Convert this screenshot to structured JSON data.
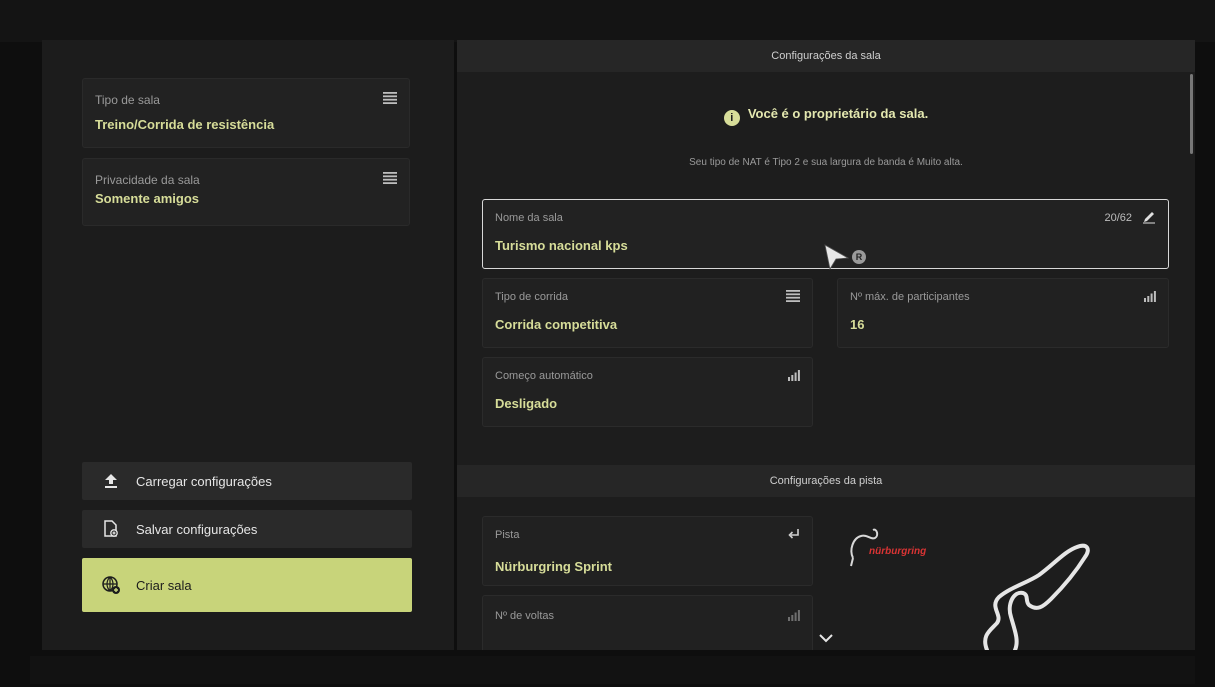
{
  "left": {
    "room_type": {
      "label": "Tipo de sala",
      "value": "Treino/Corrida de resistência",
      "icon": "list-icon"
    },
    "room_privacy": {
      "label": "Privacidade da sala",
      "value": "Somente amigos",
      "icon": "list-icon"
    },
    "buttons": {
      "load": {
        "label": "Carregar configurações",
        "icon": "upload-icon"
      },
      "save": {
        "label": "Salvar configurações",
        "icon": "save-file-icon"
      },
      "create": {
        "label": "Criar sala",
        "icon": "globe-add-icon"
      }
    }
  },
  "room_settings": {
    "header": "Configurações da sala",
    "owner_notice": "Você é o proprietário da sala.",
    "nat_info": "Seu tipo de NAT é Tipo 2 e sua largura de banda é Muito alta.",
    "room_name": {
      "label": "Nome da sala",
      "value": "Turismo nacional kps",
      "counter": "20/62",
      "icon": "pencil-icon"
    },
    "race_type": {
      "label": "Tipo de corrida",
      "value": "Corrida competitiva",
      "icon": "list-icon"
    },
    "max_participants": {
      "label": "Nº máx. de participantes",
      "value": "16",
      "icon": "bars-icon"
    },
    "auto_start": {
      "label": "Começo automático",
      "value": "Desligado",
      "icon": "bars-icon"
    }
  },
  "track_settings": {
    "header": "Configurações da pista",
    "track": {
      "label": "Pista",
      "value": "Nürburgring Sprint",
      "icon": "enter-icon"
    },
    "laps": {
      "label": "Nº de voltas",
      "icon": "bars-icon"
    },
    "logo_text": "nürburgring"
  },
  "cursor_badge": "R",
  "colors": {
    "accent": "#d7dd99",
    "primary_button": "#c8d47a",
    "panel": "#1d1d1d",
    "card": "#222222"
  }
}
